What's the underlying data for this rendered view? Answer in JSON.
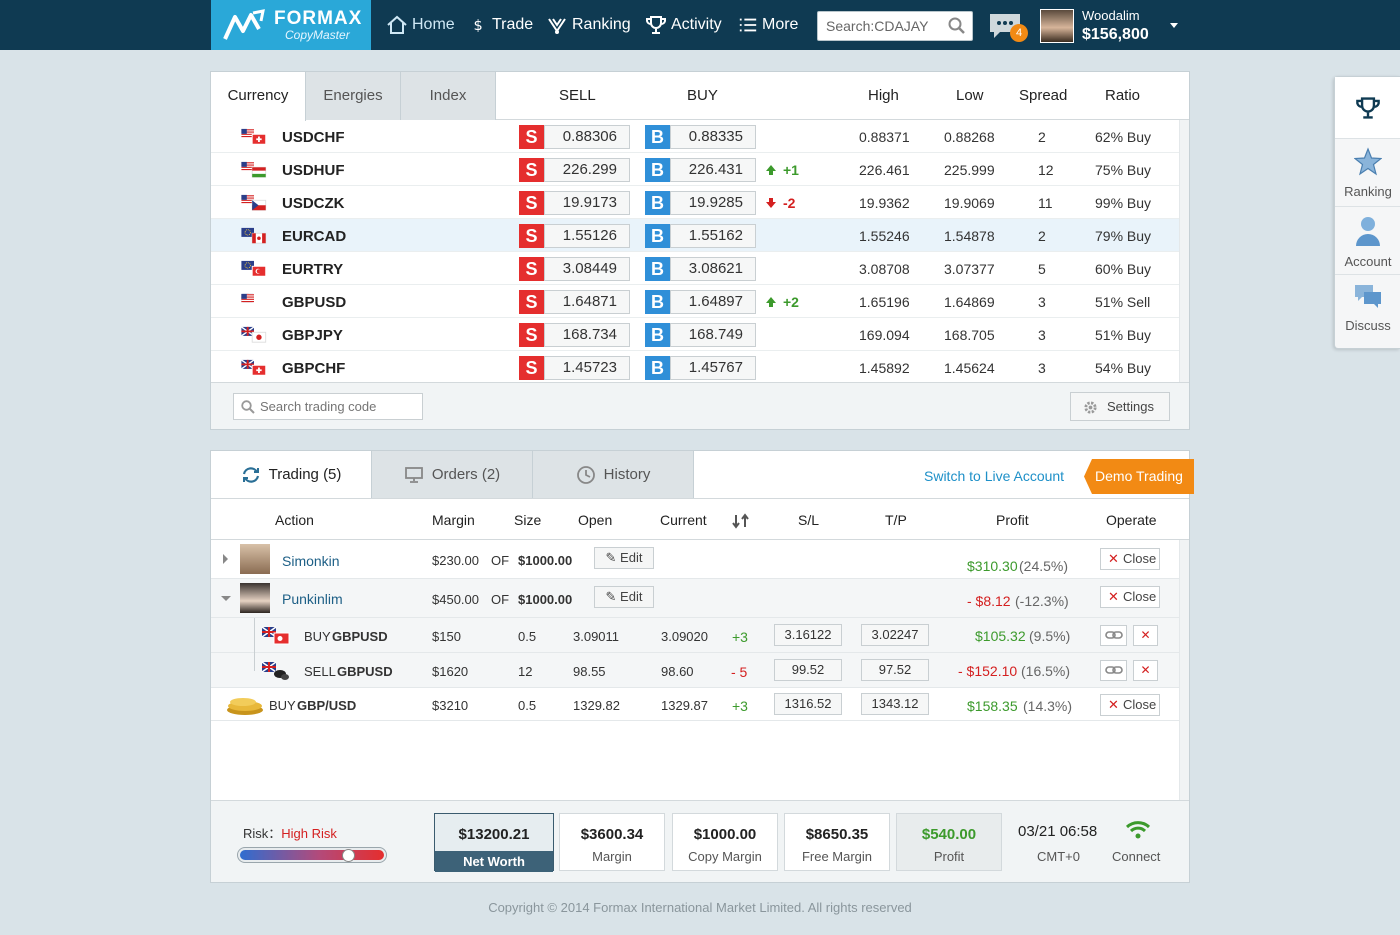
{
  "brand": {
    "name": "FORMAX",
    "product": "CopyMaster"
  },
  "nav": [
    {
      "label": "Home",
      "icon": "home-icon"
    },
    {
      "label": "Trade",
      "icon": "dollar-icon"
    },
    {
      "label": "Ranking",
      "icon": "ranking-icon"
    },
    {
      "label": "Activity",
      "icon": "trophy-icon"
    },
    {
      "label": "More",
      "icon": "menu-icon"
    }
  ],
  "search": {
    "value": "Search:CDAJAY"
  },
  "messages": {
    "count": "4"
  },
  "user": {
    "name": "Woodalim",
    "balance": "$156,800"
  },
  "quote_tabs": [
    "Currency",
    "Energies",
    "Index"
  ],
  "quote_headers": {
    "sell": "SELL",
    "buy": "BUY",
    "high": "High",
    "low": "Low",
    "spread": "Spread",
    "ratio": "Ratio"
  },
  "sell_label": "S",
  "buy_label": "B",
  "quotes": [
    {
      "symbol": "USDCHF",
      "sell": "0.88306",
      "buy": "0.88335",
      "change": "",
      "dir": "",
      "high": "0.88371",
      "low": "0.88268",
      "spread": "2",
      "ratio": "62% Buy"
    },
    {
      "symbol": "USDHUF",
      "sell": "226.299",
      "buy": "226.431",
      "change": "+1",
      "dir": "up",
      "high": "226.461",
      "low": "225.999",
      "spread": "12",
      "ratio": "75% Buy"
    },
    {
      "symbol": "USDCZK",
      "sell": "19.9173",
      "buy": "19.9285",
      "change": "-2",
      "dir": "down",
      "high": "19.9362",
      "low": "19.9069",
      "spread": "11",
      "ratio": "99% Buy"
    },
    {
      "symbol": "EURCAD",
      "sell": "1.55126",
      "buy": "1.55162",
      "change": "",
      "dir": "",
      "high": "1.55246",
      "low": "1.54878",
      "spread": "2",
      "ratio": "79% Buy"
    },
    {
      "symbol": "EURTRY",
      "sell": "3.08449",
      "buy": "3.08621",
      "change": "",
      "dir": "",
      "high": "3.08708",
      "low": "3.07377",
      "spread": "5",
      "ratio": "60% Buy"
    },
    {
      "symbol": "GBPUSD",
      "sell": "1.64871",
      "buy": "1.64897",
      "change": "+2",
      "dir": "up",
      "high": "1.65196",
      "low": "1.64869",
      "spread": "3",
      "ratio": "51% Sell"
    },
    {
      "symbol": "GBPJPY",
      "sell": "168.734",
      "buy": "168.749",
      "change": "",
      "dir": "",
      "high": "169.094",
      "low": "168.705",
      "spread": "3",
      "ratio": "51% Buy"
    },
    {
      "symbol": "GBPCHF",
      "sell": "1.45723",
      "buy": "1.45767",
      "change": "",
      "dir": "",
      "high": "1.45892",
      "low": "1.45624",
      "spread": "3",
      "ratio": "54% Buy"
    }
  ],
  "quote_search_placeholder": "Search trading code",
  "settings_label": "Settings",
  "trade_tabs": [
    "Trading (5)",
    "Orders (2)",
    "History"
  ],
  "switch_live": "Switch to Live Account",
  "demo_trading": "Demo Trading",
  "trade_headers": {
    "action": "Action",
    "margin": "Margin",
    "size": "Size",
    "open": "Open",
    "current": "Current",
    "sl": "S/L",
    "tp": "T/P",
    "profit": "Profit",
    "operate": "Operate"
  },
  "of_label": "OF",
  "edit_label": "Edit",
  "close_label": "Close",
  "x_label": "✕",
  "traders": [
    {
      "name": "Simonkin",
      "margin": "$230.00",
      "total": "$1000.00",
      "profit": "$310.30",
      "pct": "(24.5%)",
      "neg": false
    },
    {
      "name": "Punkinlim",
      "margin": "$450.00",
      "total": "$1000.00",
      "profit": "- $8.12",
      "pct": "(-12.3%)",
      "neg": true
    }
  ],
  "positions": [
    {
      "side": "BUY",
      "symbol": "GBPUSD",
      "margin": "$150",
      "size": "0.5",
      "open": "3.09011",
      "current": "3.09020",
      "pips": "+3",
      "sl": "3.16122",
      "tp": "3.02247",
      "profit": "$105.32",
      "pct": "(9.5%)",
      "neg": false
    },
    {
      "side": "SELL",
      "symbol": "GBPUSD",
      "margin": "$1620",
      "size": "12",
      "open": "98.55",
      "current": "98.60",
      "pips": "- 5",
      "sl": "99.52",
      "tp": "97.52",
      "profit": "- $152.10",
      "pct": "(16.5%)",
      "neg": true
    }
  ],
  "own_trade": {
    "side": "BUY",
    "symbol": "GBP/USD",
    "margin": "$3210",
    "size": "0.5",
    "open": "1329.82",
    "current": "1329.87",
    "pips": "+3",
    "sl": "1316.52",
    "tp": "1343.12",
    "profit": "$158.35",
    "pct": "(14.3%)"
  },
  "risk": {
    "label": "Risk：",
    "level": "High Risk",
    "value": 0.77
  },
  "stats": [
    {
      "value": "$13200.21",
      "label": "Net Worth"
    },
    {
      "value": "$3600.34",
      "label": "Margin"
    },
    {
      "value": "$1000.00",
      "label": "Copy Margin"
    },
    {
      "value": "$8650.35",
      "label": "Free Margin"
    },
    {
      "value": "$540.00",
      "label": "Profit"
    }
  ],
  "datetime": "03/21 06:58",
  "timezone": "CMT+0",
  "connect_label": "Connect",
  "copyright": "Copyright © 2014 Formax International Market Limited. All rights reserved",
  "dock": [
    {
      "label": "",
      "icon": "trophy-icon"
    },
    {
      "label": "Ranking",
      "icon": "star-icon"
    },
    {
      "label": "Account",
      "icon": "user-icon"
    },
    {
      "label": "Discuss",
      "icon": "chat-icon"
    }
  ],
  "colors": {
    "topbar": "#0f3a52",
    "logo": "#2aa8d8",
    "sell": "#e52e2e",
    "buy": "#2f8fd8",
    "up": "#3c9a2c",
    "down": "#d42020",
    "demo": "#f28a14"
  }
}
